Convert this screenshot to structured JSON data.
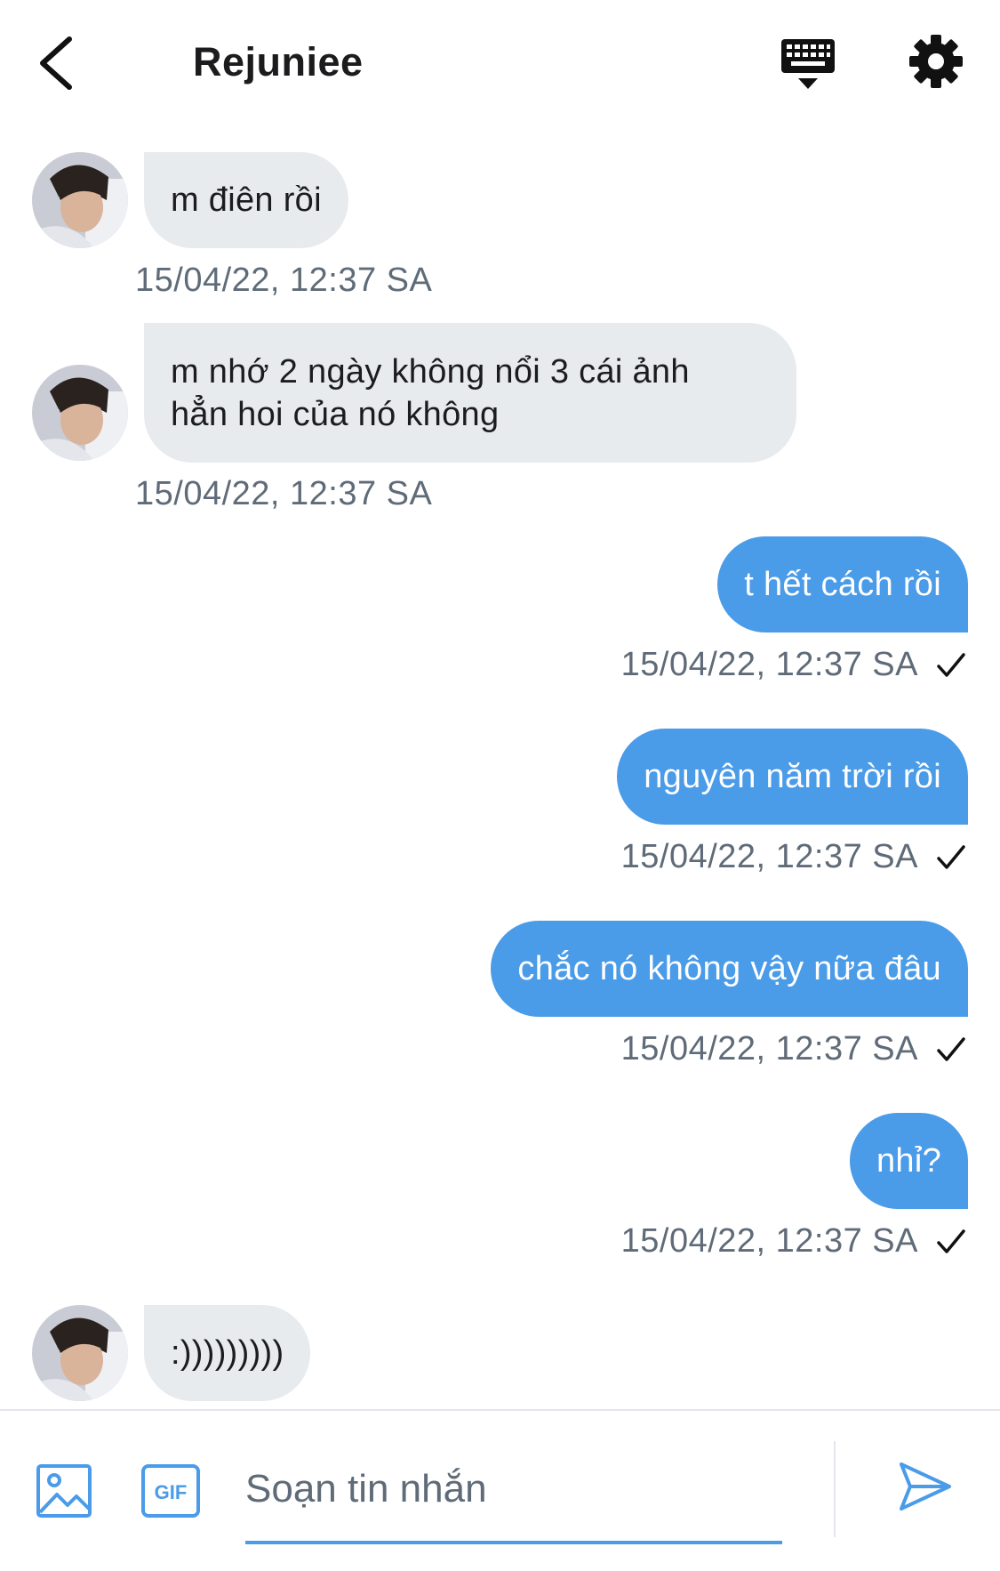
{
  "header": {
    "title": "Rejuniee",
    "icons": [
      "chevron-left-icon",
      "keyboard-icon",
      "gear-icon"
    ]
  },
  "colors": {
    "accent": "#4a9be8",
    "incoming_bubble": "#e8ebee",
    "timestamp": "#5f6b78"
  },
  "messages": [
    {
      "direction": "incoming",
      "text": "m điên rồi",
      "timestamp": "15/04/22, 12:37 SA"
    },
    {
      "direction": "incoming",
      "lines": [
        "m nhớ 2 ngày không nổi 3 cái ảnh",
        "hẳn hoi của nó không"
      ],
      "timestamp": "15/04/22, 12:37 SA"
    },
    {
      "direction": "outgoing",
      "text": "t hết cách rồi",
      "timestamp": "15/04/22, 12:37 SA",
      "status": "sent-check"
    },
    {
      "direction": "outgoing",
      "text": "nguyên năm trời rồi",
      "timestamp": "15/04/22, 12:37 SA",
      "status": "sent-check"
    },
    {
      "direction": "outgoing",
      "text": "chắc nó không vậy nữa đâu",
      "timestamp": "15/04/22, 12:37 SA",
      "status": "sent-check"
    },
    {
      "direction": "outgoing",
      "text": "nhỉ?",
      "timestamp": "15/04/22, 12:37 SA",
      "status": "sent-check"
    },
    {
      "direction": "incoming",
      "text": ":)))))))))"
    }
  ],
  "composer": {
    "placeholder": "Soạn tin nhắn",
    "value": "",
    "gif_label": "GIF",
    "icons": [
      "image-icon",
      "gif-icon",
      "send-icon"
    ]
  }
}
